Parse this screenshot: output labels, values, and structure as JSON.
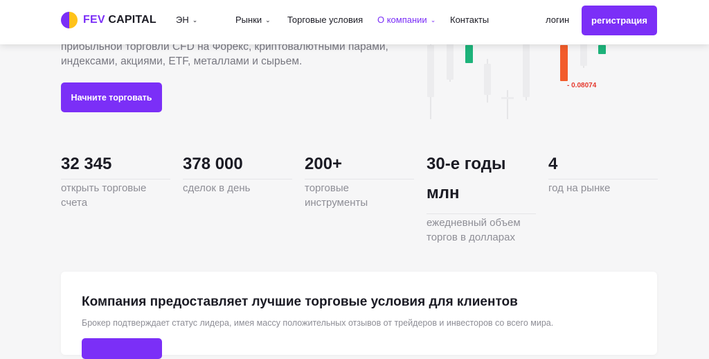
{
  "header": {
    "logo": {
      "brand": "FEV",
      "rest": " CAPITAL"
    },
    "lang": "ЭН",
    "nav": [
      {
        "label": "Рынки",
        "dropdown": true
      },
      {
        "label": "Торговые условия",
        "dropdown": false
      },
      {
        "label": "О компании",
        "dropdown": true,
        "active": true
      },
      {
        "label": "Контакты",
        "dropdown": false
      }
    ],
    "login": "логин",
    "register": "регистрация"
  },
  "hero": {
    "description": "прибыльной торговли CFD на Форекс, криптовалютными парами, индексами, акциями, ETF, металлами и сырьем.",
    "cta": "Начните торговать",
    "price_change": "- 0.08074"
  },
  "stats": [
    {
      "value": "32 345",
      "label": "открыть торговые счета"
    },
    {
      "value": "378 000",
      "label": "сделок в день"
    },
    {
      "value": "200+",
      "label": "торговые инструменты"
    },
    {
      "value": "30-е годы млн",
      "label": "ежедневный объем торгов в долларах"
    },
    {
      "value": "4",
      "label": "год на рынке"
    }
  ],
  "card": {
    "title": "Компания предоставляет лучшие торговые условия для клиентов",
    "text": "Брокер подтверждает статус лидера, имея массу положительных отзывов от трейдеров и инвесторов со всего мира."
  },
  "colors": {
    "accent": "#7b2ff7",
    "logo_yellow": "#ffc21a",
    "candle_up": "#1db37a",
    "candle_down": "#f25c2b"
  }
}
